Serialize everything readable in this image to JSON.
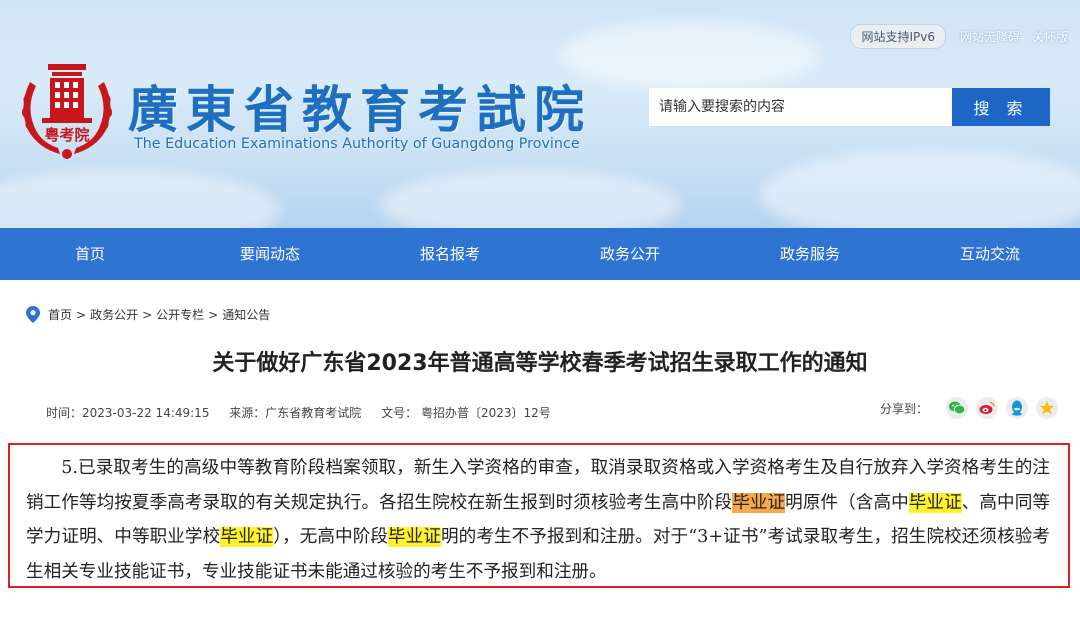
{
  "header": {
    "top_links": {
      "ipv6": "网站支持IPv6",
      "accessible": "网站无障碍",
      "care": "关怀版"
    },
    "logo": {
      "seal_text": "粤考院",
      "cn_name": "廣東省教育考試院",
      "en_name": "The Education Examinations Authority of Guangdong Province"
    },
    "search": {
      "placeholder": "请输入要搜索的内容",
      "button": "搜 索"
    }
  },
  "nav": {
    "items": [
      "首页",
      "要闻动态",
      "报名报考",
      "政务公开",
      "政务服务",
      "互动交流"
    ]
  },
  "breadcrumb": {
    "items": [
      "首页",
      "政务公开",
      "公开专栏",
      "通知公告"
    ],
    "separator": ">"
  },
  "article": {
    "title": "关于做好广东省2023年普通高等学校春季考试招生录取工作的通知",
    "meta": {
      "time": "时间：2023-03-22 14:49:15",
      "source": "来源：广东省教育考试院",
      "doc_no": "文号： 粤招办普〔2023〕12号"
    },
    "share_label": "分享到：",
    "share_icons": [
      "wechat-icon",
      "weibo-icon",
      "qq-icon",
      "qzone-icon"
    ],
    "paragraph": {
      "part1": "5.已录取考生的高级中等教育阶段档案领取，新生入学资格的审查，取消录取资格或入学资格考生及自行放弃入学资格考生的注销工作等均按夏季高考录取的有关规定执行。各招生院校在新生报到时须核验考生高中阶段",
      "hl1": "毕业证",
      "part2": "明原件（含高中",
      "hl2": "毕业证",
      "part3": "、高中同等学力证明、中等职业学校",
      "hl3": "毕业证",
      "part4": "），无高中阶段",
      "hl4": "毕业证",
      "part5": "明的考生不予报到和注册。对于“3+证书”考试录取考生，招生院校还须核验考生相关专业技能证书，专业技能证书未能通过核验的考生不予报到和注册。"
    }
  },
  "colors": {
    "brand_blue": "#2f74d2",
    "search_blue": "#1e66c6",
    "emblem_red": "#c8161d",
    "frame_red": "#e0201e",
    "highlight_orange": "#f7a94a",
    "highlight_yellow": "#fff22a"
  }
}
